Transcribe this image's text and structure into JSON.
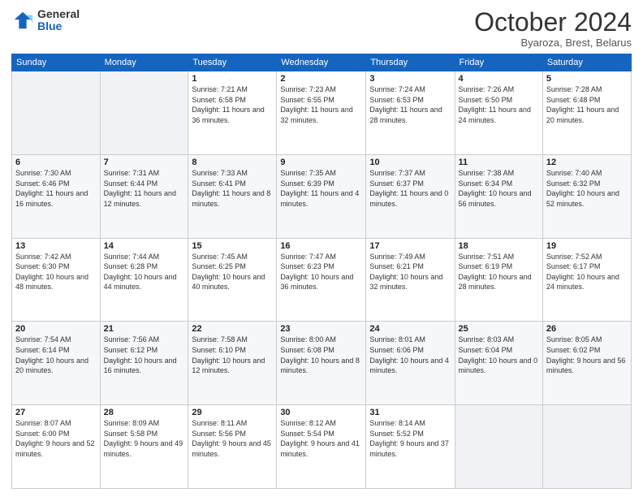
{
  "logo": {
    "general": "General",
    "blue": "Blue"
  },
  "header": {
    "month": "October 2024",
    "location": "Byaroza, Brest, Belarus"
  },
  "days_of_week": [
    "Sunday",
    "Monday",
    "Tuesday",
    "Wednesday",
    "Thursday",
    "Friday",
    "Saturday"
  ],
  "weeks": [
    [
      {
        "day": "",
        "info": ""
      },
      {
        "day": "",
        "info": ""
      },
      {
        "day": "1",
        "info": "Sunrise: 7:21 AM\nSunset: 6:58 PM\nDaylight: 11 hours\nand 36 minutes."
      },
      {
        "day": "2",
        "info": "Sunrise: 7:23 AM\nSunset: 6:55 PM\nDaylight: 11 hours\nand 32 minutes."
      },
      {
        "day": "3",
        "info": "Sunrise: 7:24 AM\nSunset: 6:53 PM\nDaylight: 11 hours\nand 28 minutes."
      },
      {
        "day": "4",
        "info": "Sunrise: 7:26 AM\nSunset: 6:50 PM\nDaylight: 11 hours\nand 24 minutes."
      },
      {
        "day": "5",
        "info": "Sunrise: 7:28 AM\nSunset: 6:48 PM\nDaylight: 11 hours\nand 20 minutes."
      }
    ],
    [
      {
        "day": "6",
        "info": "Sunrise: 7:30 AM\nSunset: 6:46 PM\nDaylight: 11 hours\nand 16 minutes."
      },
      {
        "day": "7",
        "info": "Sunrise: 7:31 AM\nSunset: 6:44 PM\nDaylight: 11 hours\nand 12 minutes."
      },
      {
        "day": "8",
        "info": "Sunrise: 7:33 AM\nSunset: 6:41 PM\nDaylight: 11 hours\nand 8 minutes."
      },
      {
        "day": "9",
        "info": "Sunrise: 7:35 AM\nSunset: 6:39 PM\nDaylight: 11 hours\nand 4 minutes."
      },
      {
        "day": "10",
        "info": "Sunrise: 7:37 AM\nSunset: 6:37 PM\nDaylight: 11 hours\nand 0 minutes."
      },
      {
        "day": "11",
        "info": "Sunrise: 7:38 AM\nSunset: 6:34 PM\nDaylight: 10 hours\nand 56 minutes."
      },
      {
        "day": "12",
        "info": "Sunrise: 7:40 AM\nSunset: 6:32 PM\nDaylight: 10 hours\nand 52 minutes."
      }
    ],
    [
      {
        "day": "13",
        "info": "Sunrise: 7:42 AM\nSunset: 6:30 PM\nDaylight: 10 hours\nand 48 minutes."
      },
      {
        "day": "14",
        "info": "Sunrise: 7:44 AM\nSunset: 6:28 PM\nDaylight: 10 hours\nand 44 minutes."
      },
      {
        "day": "15",
        "info": "Sunrise: 7:45 AM\nSunset: 6:25 PM\nDaylight: 10 hours\nand 40 minutes."
      },
      {
        "day": "16",
        "info": "Sunrise: 7:47 AM\nSunset: 6:23 PM\nDaylight: 10 hours\nand 36 minutes."
      },
      {
        "day": "17",
        "info": "Sunrise: 7:49 AM\nSunset: 6:21 PM\nDaylight: 10 hours\nand 32 minutes."
      },
      {
        "day": "18",
        "info": "Sunrise: 7:51 AM\nSunset: 6:19 PM\nDaylight: 10 hours\nand 28 minutes."
      },
      {
        "day": "19",
        "info": "Sunrise: 7:52 AM\nSunset: 6:17 PM\nDaylight: 10 hours\nand 24 minutes."
      }
    ],
    [
      {
        "day": "20",
        "info": "Sunrise: 7:54 AM\nSunset: 6:14 PM\nDaylight: 10 hours\nand 20 minutes."
      },
      {
        "day": "21",
        "info": "Sunrise: 7:56 AM\nSunset: 6:12 PM\nDaylight: 10 hours\nand 16 minutes."
      },
      {
        "day": "22",
        "info": "Sunrise: 7:58 AM\nSunset: 6:10 PM\nDaylight: 10 hours\nand 12 minutes."
      },
      {
        "day": "23",
        "info": "Sunrise: 8:00 AM\nSunset: 6:08 PM\nDaylight: 10 hours\nand 8 minutes."
      },
      {
        "day": "24",
        "info": "Sunrise: 8:01 AM\nSunset: 6:06 PM\nDaylight: 10 hours\nand 4 minutes."
      },
      {
        "day": "25",
        "info": "Sunrise: 8:03 AM\nSunset: 6:04 PM\nDaylight: 10 hours\nand 0 minutes."
      },
      {
        "day": "26",
        "info": "Sunrise: 8:05 AM\nSunset: 6:02 PM\nDaylight: 9 hours\nand 56 minutes."
      }
    ],
    [
      {
        "day": "27",
        "info": "Sunrise: 8:07 AM\nSunset: 6:00 PM\nDaylight: 9 hours\nand 52 minutes."
      },
      {
        "day": "28",
        "info": "Sunrise: 8:09 AM\nSunset: 5:58 PM\nDaylight: 9 hours\nand 49 minutes."
      },
      {
        "day": "29",
        "info": "Sunrise: 8:11 AM\nSunset: 5:56 PM\nDaylight: 9 hours\nand 45 minutes."
      },
      {
        "day": "30",
        "info": "Sunrise: 8:12 AM\nSunset: 5:54 PM\nDaylight: 9 hours\nand 41 minutes."
      },
      {
        "day": "31",
        "info": "Sunrise: 8:14 AM\nSunset: 5:52 PM\nDaylight: 9 hours\nand 37 minutes."
      },
      {
        "day": "",
        "info": ""
      },
      {
        "day": "",
        "info": ""
      }
    ]
  ]
}
